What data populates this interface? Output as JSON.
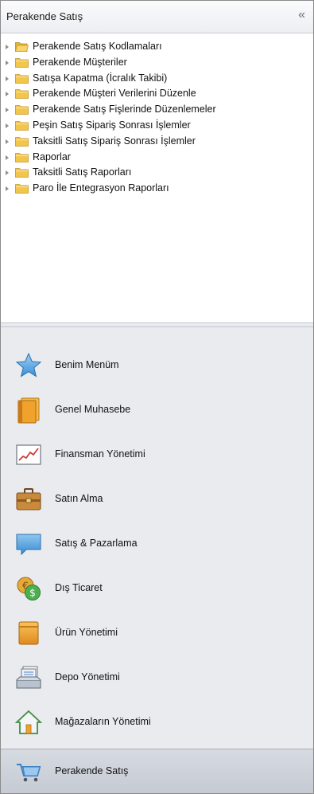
{
  "panel": {
    "title": "Perakende Satış",
    "collapse_glyph": "«"
  },
  "tree": {
    "items": [
      {
        "label": "Perakende Satış Kodlamaları",
        "icon": "folder-open-icon"
      },
      {
        "label": "Perakende Müşteriler",
        "icon": "folder-icon"
      },
      {
        "label": "Satışa Kapatma (İcralık Takibi)",
        "icon": "folder-icon"
      },
      {
        "label": "Perakende Müşteri Verilerini Düzenle",
        "icon": "folder-icon"
      },
      {
        "label": "Perakende Satış Fişlerinde Düzenlemeler",
        "icon": "folder-icon"
      },
      {
        "label": "Peşin Satış Sipariş Sonrası İşlemler",
        "icon": "folder-icon"
      },
      {
        "label": "Taksitli Satış Sipariş Sonrası İşlemler",
        "icon": "folder-icon"
      },
      {
        "label": "Raporlar",
        "icon": "folder-icon"
      },
      {
        "label": "Taksitli Satış Raporları",
        "icon": "folder-icon"
      },
      {
        "label": "Paro İle Entegrasyon Raporları",
        "icon": "folder-icon"
      }
    ]
  },
  "nav": {
    "items": [
      {
        "label": "Benim Menüm",
        "icon": "star-icon"
      },
      {
        "label": "Genel Muhasebe",
        "icon": "ledger-books-icon"
      },
      {
        "label": "Finansman Yönetimi",
        "icon": "line-chart-icon"
      },
      {
        "label": "Satın Alma",
        "icon": "briefcase-icon"
      },
      {
        "label": "Satış & Pazarlama",
        "icon": "speech-bubble-icon"
      },
      {
        "label": "Dış Ticaret",
        "icon": "currency-coins-icon"
      },
      {
        "label": "Ürün Yönetimi",
        "icon": "product-box-icon"
      },
      {
        "label": "Depo Yönetimi",
        "icon": "warehouse-tray-icon"
      },
      {
        "label": "Mağazaların Yönetimi",
        "icon": "house-icon"
      },
      {
        "label": "Perakende Satış",
        "icon": "shopping-cart-icon",
        "selected": true
      }
    ]
  },
  "colors": {
    "nav_background": "#e9ebef",
    "selected_background": "#c9ced6",
    "folder": "#f2c64a"
  }
}
